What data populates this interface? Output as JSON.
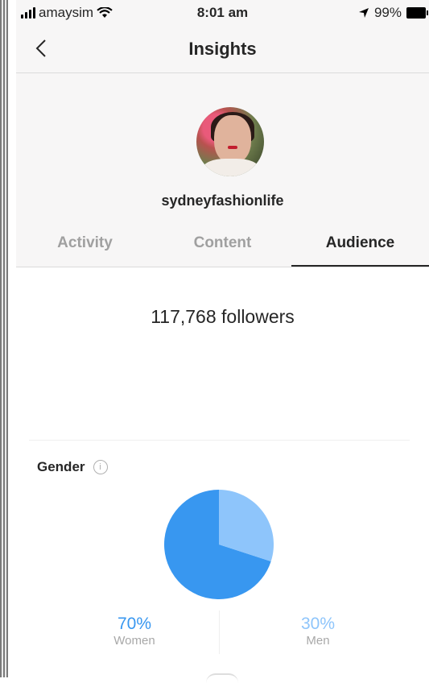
{
  "status_bar": {
    "carrier": "amaysim",
    "time": "8:01 am",
    "battery": "99%"
  },
  "header": {
    "title": "Insights"
  },
  "profile": {
    "username": "sydneyfashionlife"
  },
  "tabs": [
    {
      "label": "Activity",
      "active": false
    },
    {
      "label": "Content",
      "active": false
    },
    {
      "label": "Audience",
      "active": true
    }
  ],
  "audience": {
    "followers_text": "117,768 followers",
    "gender": {
      "title": "Gender",
      "women": {
        "label": "Women",
        "percent": "70%",
        "value": 70,
        "color": "#3897f0"
      },
      "men": {
        "label": "Men",
        "percent": "30%",
        "value": 30,
        "color": "#8ec5fb"
      }
    }
  },
  "colors": {
    "accent_blue": "#3897f0",
    "light_blue": "#8ec5fb"
  }
}
